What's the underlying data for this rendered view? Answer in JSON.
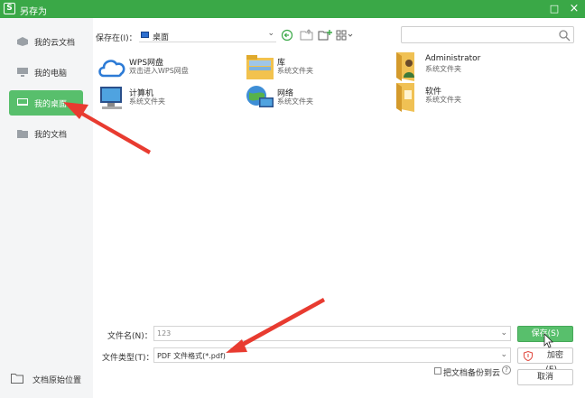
{
  "window": {
    "title": "另存为",
    "logo_glyph": "S",
    "max_glyph": "□",
    "close_glyph": "×"
  },
  "sidebar": {
    "items": [
      {
        "label": "我的云文档",
        "icon": "cloud-doc-icon"
      },
      {
        "label": "我的电脑",
        "icon": "computer-icon"
      },
      {
        "label": "我的桌面",
        "icon": "desktop-icon",
        "active": true
      },
      {
        "label": "我的文档",
        "icon": "folder-icon"
      }
    ],
    "bottom_label": "文档原始位置"
  },
  "location": {
    "label": "保存在(I)：",
    "current": "桌面",
    "search_placeholder": ""
  },
  "files": [
    {
      "name": "WPS网盘",
      "sub": "双击进入WPS网盘",
      "icon": "wps-cloud-icon"
    },
    {
      "name": "库",
      "sub": "系统文件夹",
      "icon": "library-icon"
    },
    {
      "name": "Administrator",
      "sub": "系统文件夹",
      "icon": "user-folder-icon"
    },
    {
      "name": "计算机",
      "sub": "系统文件夹",
      "icon": "computer-icon"
    },
    {
      "name": "网络",
      "sub": "系统文件夹",
      "icon": "network-icon"
    },
    {
      "name": "软件",
      "sub": "系统文件夹",
      "icon": "folder-icon"
    }
  ],
  "form": {
    "filename_label": "文件名(N)：",
    "filename_value": "123",
    "filetype_label": "文件类型(T)：",
    "filetype_value": "PDF 文件格式(*.pdf)",
    "backup_label": "把文档备份到云",
    "help_glyph": "?",
    "save_button": "保存(S)",
    "encrypt_button": "加密(E)...",
    "cancel_button": "取消"
  },
  "colors": {
    "accent": "#3aa847",
    "active": "#58bf6c",
    "arrow": "#e83b30"
  }
}
